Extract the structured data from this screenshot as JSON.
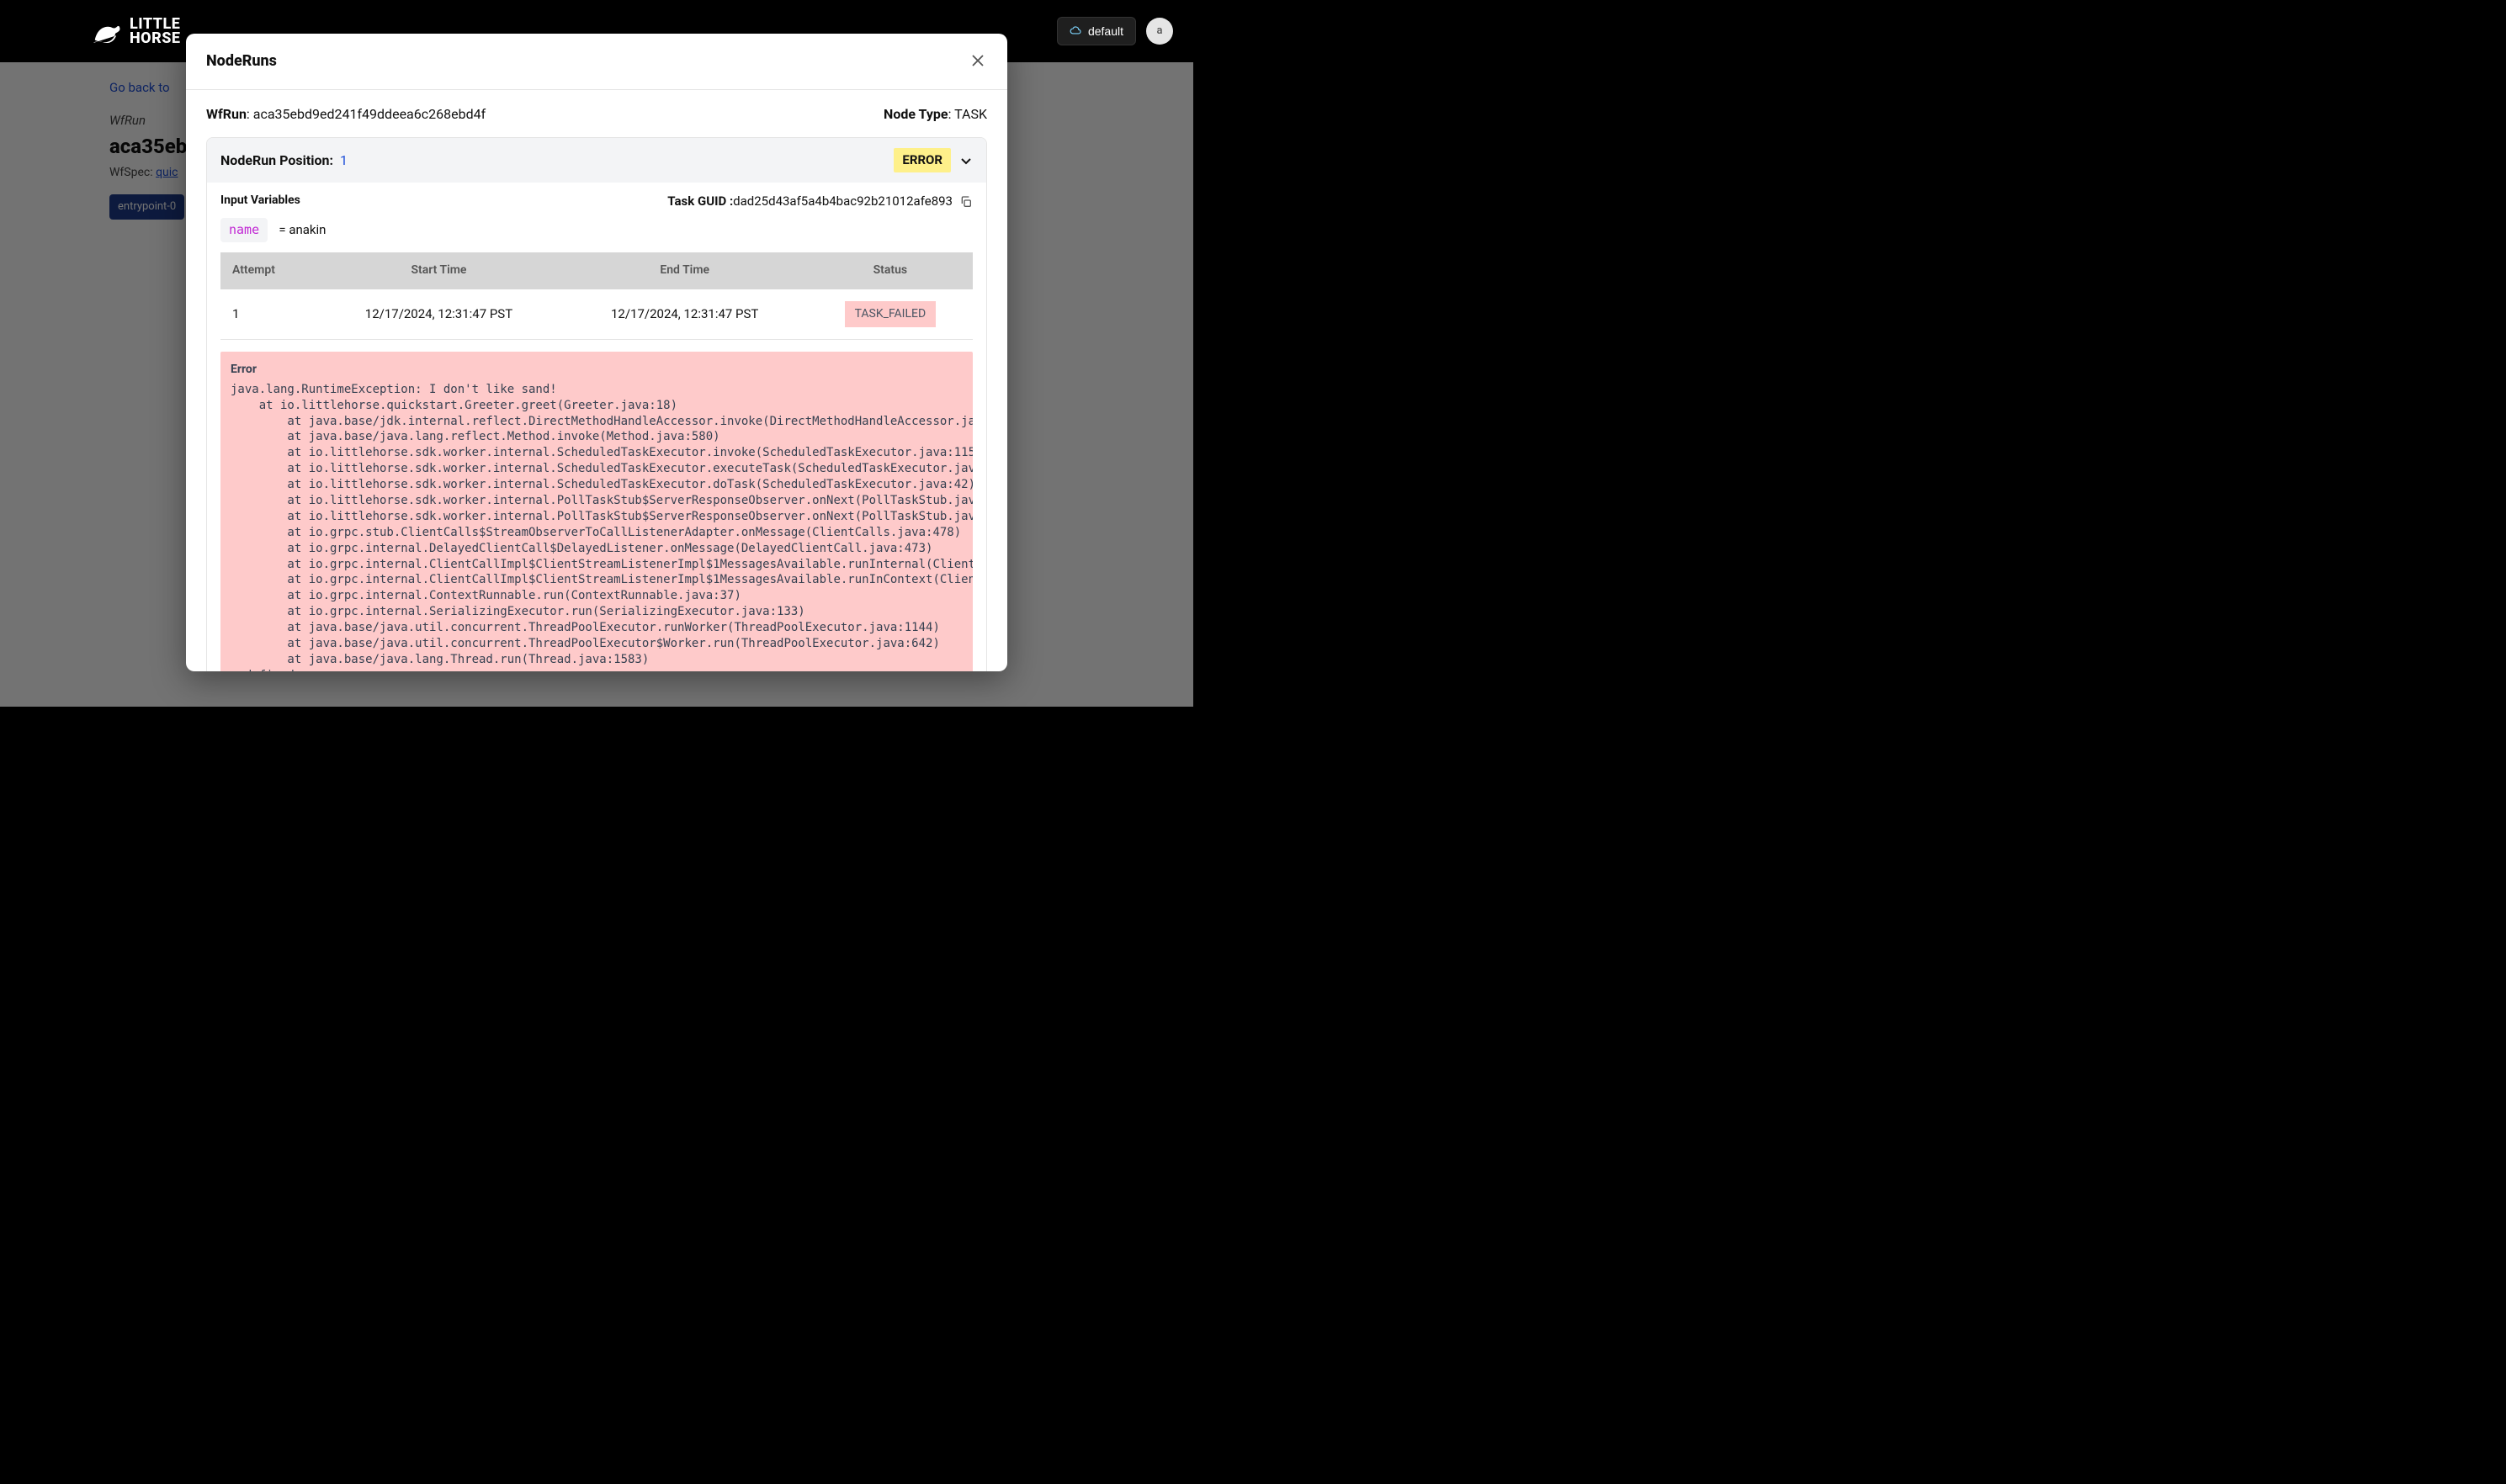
{
  "brand": {
    "line1": "LITTLE",
    "line2": "HORSE"
  },
  "topbar": {
    "tenant_label": "default",
    "avatar_initial": "a"
  },
  "page": {
    "go_back": "Go back to",
    "wfrun_label": "WfRun",
    "wfrun_id_preview": "aca35eb",
    "wfspec_label": "WfSpec:",
    "wfspec_link": "quic",
    "entrypoint_chip": "entrypoint-0"
  },
  "modal": {
    "title": "NodeRuns",
    "wfrun_label": "WfRun",
    "wfrun_id": "aca35ebd9ed241f49ddeea6c268ebd4f",
    "nodetype_label": "Node Type",
    "nodetype_value": "TASK",
    "noderun_position_label": "NodeRun Position:",
    "noderun_position_value": "1",
    "status_badge": "ERROR",
    "input_vars_title": "Input Variables",
    "input_var_name": "name",
    "input_var_eq": "=",
    "input_var_value": "anakin",
    "task_guid_label": "Task GUID :",
    "task_guid_value": "dad25d43af5a4b4bac92b21012afe893",
    "table": {
      "headers": [
        "Attempt",
        "Start Time",
        "End Time",
        "Status"
      ],
      "rows": [
        {
          "attempt": "1",
          "start": "12/17/2024, 12:31:47 PST",
          "end": "12/17/2024, 12:31:47 PST",
          "status": "TASK_FAILED"
        }
      ]
    },
    "error_label": "Error",
    "error_text": "java.lang.RuntimeException: I don't like sand!\n    at io.littlehorse.quickstart.Greeter.greet(Greeter.java:18)\n        at java.base/jdk.internal.reflect.DirectMethodHandleAccessor.invoke(DirectMethodHandleAccessor.java:103)\n        at java.base/java.lang.reflect.Method.invoke(Method.java:580)\n        at io.littlehorse.sdk.worker.internal.ScheduledTaskExecutor.invoke(ScheduledTaskExecutor.java:115)\n        at io.littlehorse.sdk.worker.internal.ScheduledTaskExecutor.executeTask(ScheduledTaskExecutor.java:68)\n        at io.littlehorse.sdk.worker.internal.ScheduledTaskExecutor.doTask(ScheduledTaskExecutor.java:42)\n        at io.littlehorse.sdk.worker.internal.PollTaskStub$ServerResponseObserver.onNext(PollTaskStub.java:87)\n        at io.littlehorse.sdk.worker.internal.PollTaskStub$ServerResponseObserver.onNext(PollTaskStub.java:77)\n        at io.grpc.stub.ClientCalls$StreamObserverToCallListenerAdapter.onMessage(ClientCalls.java:478)\n        at io.grpc.internal.DelayedClientCall$DelayedListener.onMessage(DelayedClientCall.java:473)\n        at io.grpc.internal.ClientCallImpl$ClientStreamListenerImpl$1MessagesAvailable.runInternal(ClientCallImpl.j\n        at io.grpc.internal.ClientCallImpl$ClientStreamListenerImpl$1MessagesAvailable.runInContext(ClientCallImpl.\n        at io.grpc.internal.ContextRunnable.run(ContextRunnable.java:37)\n        at io.grpc.internal.SerializingExecutor.run(SerializingExecutor.java:133)\n        at java.base/java.util.concurrent.ThreadPoolExecutor.runWorker(ThreadPoolExecutor.java:1144)\n        at java.base/java.util.concurrent.ThreadPoolExecutor$Worker.run(ThreadPoolExecutor.java:642)\n        at java.base/java.lang.Thread.run(Thread.java:1583)\nundefined"
  }
}
